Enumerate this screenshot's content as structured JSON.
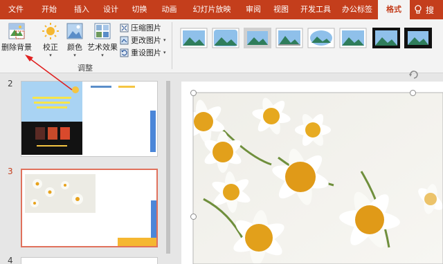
{
  "tabs": [
    {
      "label": "文件",
      "active": false
    },
    {
      "label": "开始",
      "active": false
    },
    {
      "label": "插入",
      "active": false
    },
    {
      "label": "设计",
      "active": false
    },
    {
      "label": "切换",
      "active": false
    },
    {
      "label": "动画",
      "active": false
    },
    {
      "label": "幻灯片放映",
      "active": false
    },
    {
      "label": "审阅",
      "active": false
    },
    {
      "label": "视图",
      "active": false
    },
    {
      "label": "开发工具",
      "active": false
    },
    {
      "label": "办公标签",
      "active": false
    },
    {
      "label": "格式",
      "active": true
    }
  ],
  "tell_me": {
    "label": "搜",
    "icon": "lightbulb-icon"
  },
  "ribbon": {
    "remove_bg": "删除背景",
    "corrections": "校正",
    "color": "颜色",
    "artistic": "艺术效果",
    "compress": "压缩图片",
    "change": "更改图片",
    "reset": "重设图片",
    "group_adjust": "调整"
  },
  "slides": [
    {
      "number": "2",
      "selected": false
    },
    {
      "number": "3",
      "selected": true
    },
    {
      "number": "4",
      "selected": false
    }
  ],
  "colors": {
    "accent": "#c43e1c",
    "selection": "#e0715c",
    "arrow": "#e02020",
    "daisy_center": "#e8a21c"
  }
}
